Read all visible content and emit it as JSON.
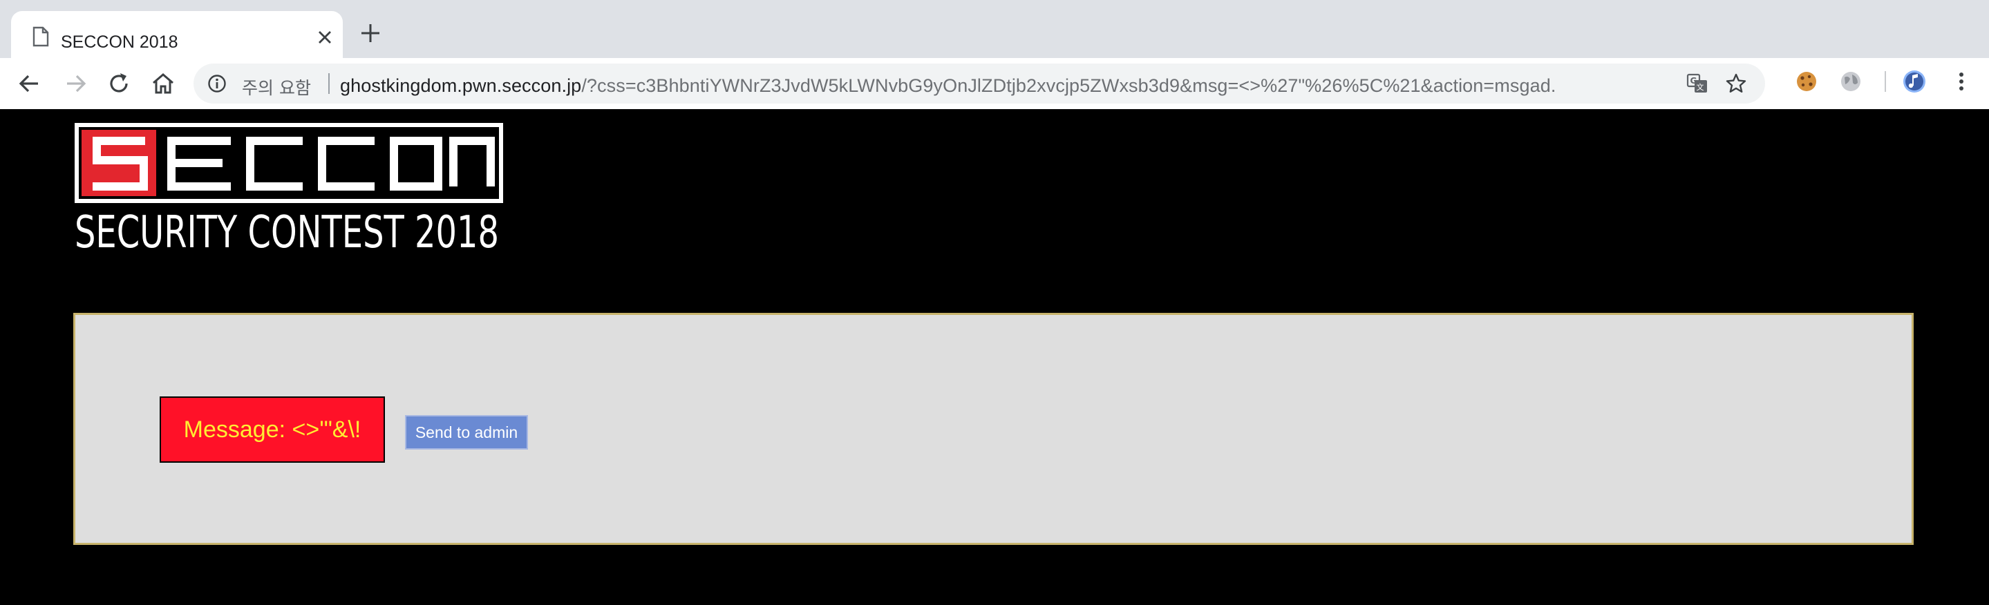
{
  "browser": {
    "tab_title": "SECCON 2018",
    "security_warning": "주의 요함",
    "url_host": "ghostkingdom.pwn.seccon.jp",
    "url_rest": "/?css=c3BhbntiYWNrZ3JvdW5kLWNvbG9yOnJlZDtjb2xvcjp5ZWxsb3d9&msg=<>%27\"%26%5C%21&action=msgad..."
  },
  "logo": {
    "wordmark": "SECCON",
    "tagline": "SECURITY CONTEST 2018"
  },
  "main": {
    "message": "Message: <>'\"&\\!",
    "send_button": "Send to admin"
  },
  "colors": {
    "page_bg": "#000000",
    "panel_bg": "#dedede",
    "panel_border": "#c7b36b",
    "message_bg": "#ff1128",
    "message_text": "#ffee33",
    "button_bg": "#6a8ad3",
    "logo_red": "#e3262e"
  }
}
